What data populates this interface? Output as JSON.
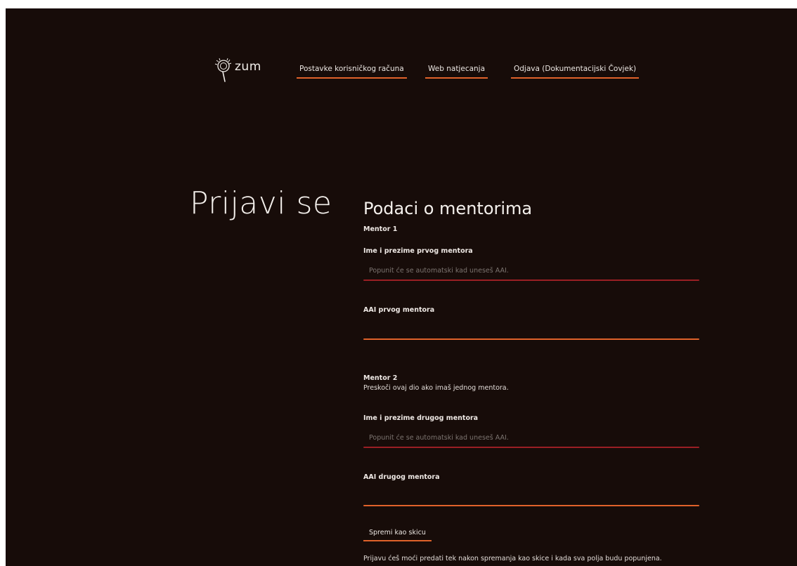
{
  "header": {
    "logo_text": "zum",
    "nav": [
      {
        "label": "Postavke korisničkog računa"
      },
      {
        "label": "Web natjecanja"
      },
      {
        "label": "Odjava (Dokumentacijski Čovjek)"
      }
    ]
  },
  "page": {
    "title": "Prijavi se"
  },
  "form": {
    "section_title": "Podaci o mentorima",
    "mentor1": {
      "heading": "Mentor 1",
      "name_label": "Ime i prezime prvog mentora",
      "name_placeholder": "Popunit će se automatski kad uneseš AAI.",
      "aai_label": "AAI prvog mentora",
      "aai_value": ""
    },
    "mentor2": {
      "heading": "Mentor 2",
      "hint": "Preskoči ovaj dio ako imaš jednog mentora.",
      "name_label": "Ime i prezime drugog mentora",
      "name_placeholder": "Popunit će se automatski kad uneseš AAI.",
      "aai_label": "AAI drugog mentora",
      "aai_value": ""
    },
    "save_draft_label": "Spremi kao skicu",
    "footer_note": "Prijavu ćeš moći predati tek nakon spremanja kao skice i kada sva polja budu popunjena."
  },
  "colors": {
    "background": "#170c09",
    "accent_orange": "#e0622a",
    "accent_red": "#9a1f24",
    "text": "#ece7e3"
  }
}
